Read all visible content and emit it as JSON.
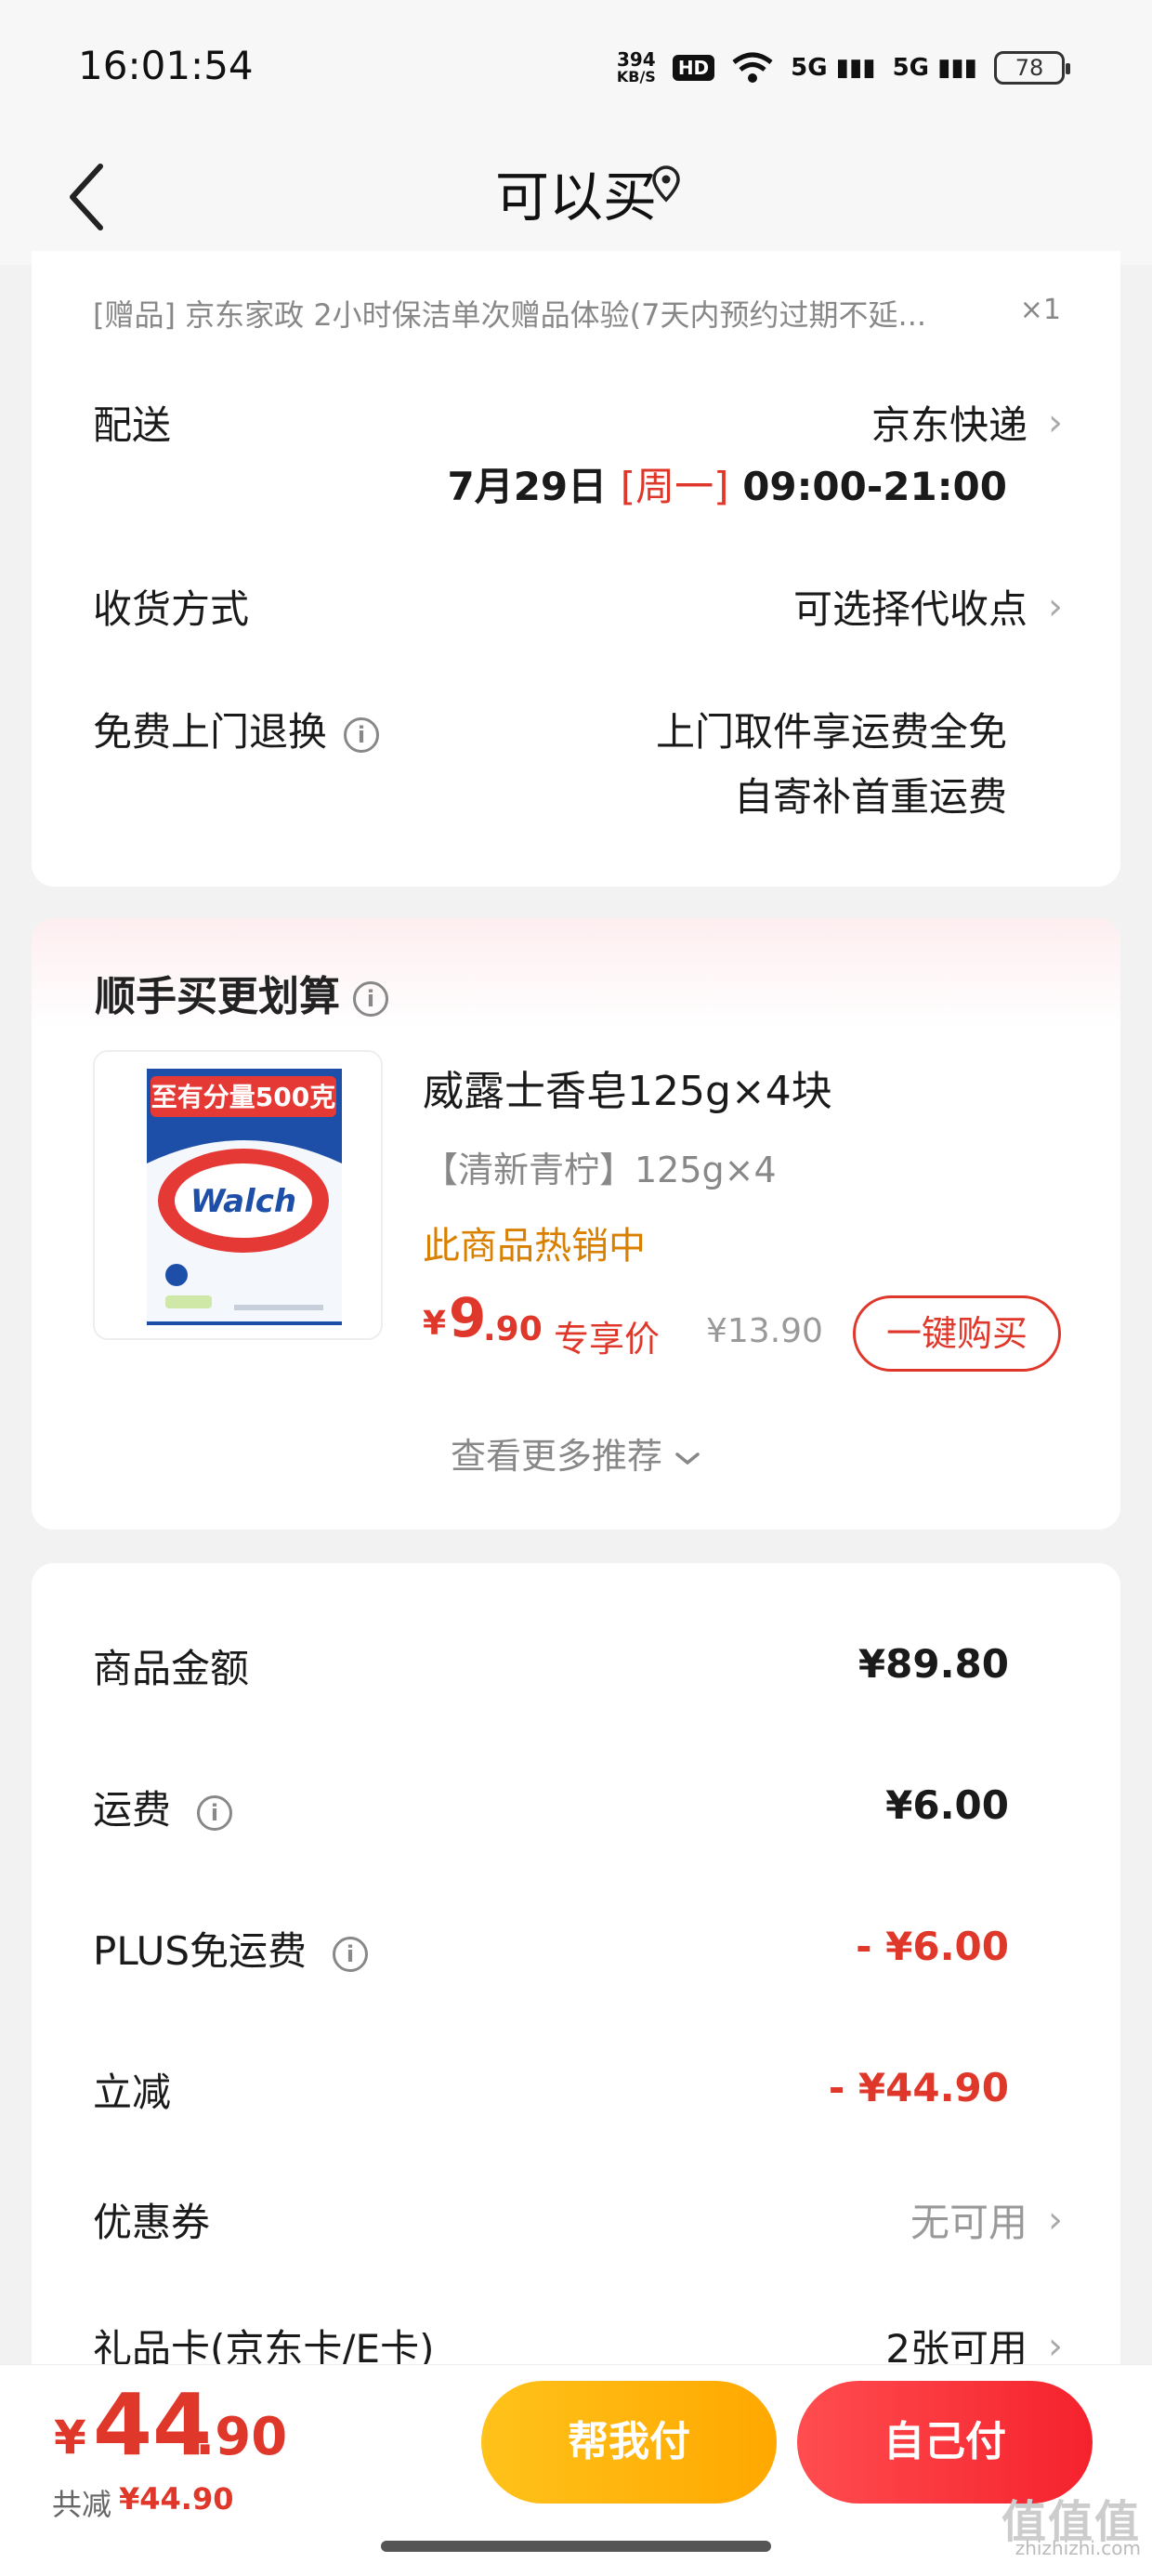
{
  "status_bar": {
    "time": "16:01:54",
    "net_speed_value": "394",
    "net_speed_unit": "KB/S",
    "hd_badge": "HD",
    "signal_1": "5G",
    "signal_2": "5G",
    "battery": "78"
  },
  "header": {
    "title": "可以买",
    "back_icon": "chevron-left-icon",
    "location_icon": "location-pin-icon"
  },
  "delivery_card": {
    "gift_text": "[赠品]  京东家政 2小时保洁单次赠品体验(7天内预约过期不延...",
    "gift_qty": "×1",
    "shipping_label": "配送",
    "shipping_value": "京东快递",
    "shipping_date": "7月29日",
    "shipping_weekday": "[周一]",
    "shipping_time": "09:00-21:00",
    "receive_label": "收货方式",
    "receive_value": "可选择代收点",
    "return_label": "免费上门退换",
    "return_value_1": "上门取件享运费全免",
    "return_value_2": "自寄补首重运费"
  },
  "recommend_card": {
    "title": "顺手买更划算",
    "product_name": "威露士香皂125g×4块",
    "product_spec": "【清新青柠】125g×4",
    "product_hot": "此商品热销中",
    "price_currency": "¥",
    "price_int": "9",
    "price_dec": ".90",
    "price_tag": "专享价",
    "price_original": "¥13.90",
    "buy_button": "一键购买",
    "more_label": "查看更多推荐",
    "image_banner": "至有分量500克",
    "image_brand": "Walch"
  },
  "summary_card": {
    "rows": [
      {
        "label": "商品金额",
        "value": "¥89.80"
      },
      {
        "label": "运费",
        "value": "¥6.00"
      },
      {
        "label": "PLUS免运费",
        "value": "- ¥6.00"
      },
      {
        "label": "立减",
        "value": "- ¥44.90"
      },
      {
        "label": "优惠券",
        "value": "无可用"
      },
      {
        "label": "礼品卡(京东卡/E卡)",
        "value": "2张可用"
      }
    ]
  },
  "bottom_bar": {
    "total_currency": "¥",
    "total_int": "44",
    "total_dec": ".90",
    "saved_label": "共减",
    "saved_amount": "¥44.90",
    "help_pay_button": "帮我付",
    "self_pay_button": "自己付"
  },
  "watermark": {
    "big": "值值值",
    "small": "zhizhizhi.com"
  },
  "colors": {
    "accent_red": "#e0372b",
    "hot_orange": "#d98000",
    "help_button": "#ffb000",
    "self_button": "#f5222d"
  }
}
